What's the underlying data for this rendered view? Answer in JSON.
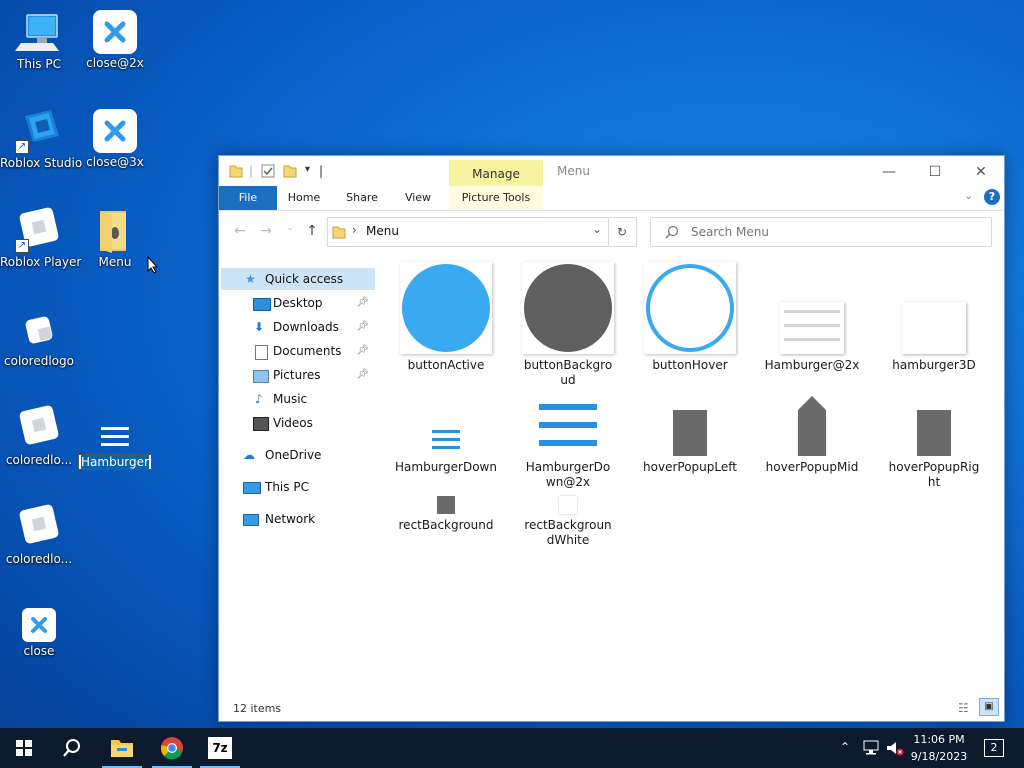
{
  "desktop": {
    "icons": [
      {
        "label": "This PC"
      },
      {
        "label": "close@2x"
      },
      {
        "label": "Roblox Studio"
      },
      {
        "label": "close@3x"
      },
      {
        "label": "Roblox Player"
      },
      {
        "label": "Menu"
      },
      {
        "label": "coloredlogo"
      },
      {
        "label": "coloredlo..."
      },
      {
        "label": "Hamburger"
      },
      {
        "label": "coloredlo..."
      },
      {
        "label": "close"
      }
    ]
  },
  "explorer": {
    "title": "Menu",
    "context_tab": "Manage",
    "ribbon_tabs": [
      "File",
      "Home",
      "Share",
      "View",
      "Picture Tools"
    ],
    "address": "Menu",
    "search_placeholder": "Search Menu",
    "nav": {
      "quick_access": "Quick access",
      "items": [
        "Desktop",
        "Downloads",
        "Documents",
        "Pictures",
        "Music",
        "Videos"
      ],
      "onedrive": "OneDrive",
      "this_pc": "This PC",
      "network": "Network"
    },
    "files": [
      {
        "name": "buttonActive"
      },
      {
        "name": "buttonBackgroud"
      },
      {
        "name": "buttonHover"
      },
      {
        "name": "Hamburger@2x"
      },
      {
        "name": "hamburger3D"
      },
      {
        "name": "HamburgerDown"
      },
      {
        "name": "HamburgerDown@2x"
      },
      {
        "name": "hoverPopupLeft"
      },
      {
        "name": "hoverPopupMid"
      },
      {
        "name": "hoverPopupRight"
      },
      {
        "name": "rectBackground"
      },
      {
        "name": "rectBackgroundWhite"
      }
    ],
    "status": "12 items"
  },
  "taskbar": {
    "time": "11:06 PM",
    "date": "9/18/2023",
    "notifications": "2",
    "app_7z": "7z"
  },
  "colors": {
    "accent": "#1a6fc0",
    "circle_blue": "#39aaf0",
    "circle_gray": "#5f5f5f",
    "hamburger_blue": "#2b8fe0",
    "context_tab": "#f7f2a0"
  }
}
